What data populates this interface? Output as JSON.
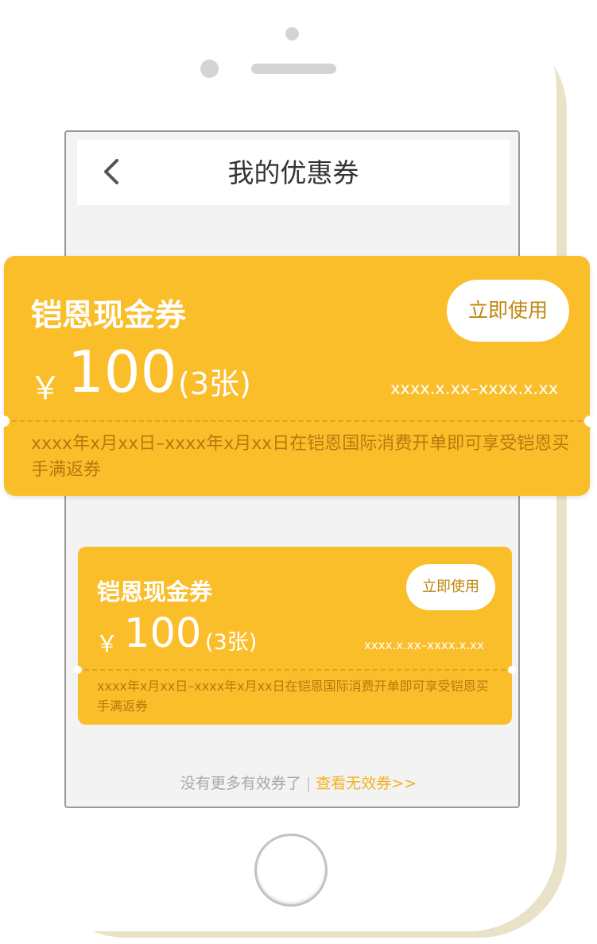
{
  "header": {
    "title": "我的优惠券"
  },
  "coupons": [
    {
      "name": "铠恩现金券",
      "action_label": "立即使用",
      "currency": "￥",
      "amount": "100",
      "count": "(3张)",
      "validity": "xxxx.x.xx–xxxx.x.xx",
      "description": "xxxx年x月xx日–xxxx年x月xx日在铠恩国际消费开单即可享受铠恩买手满返券"
    },
    {
      "name": "铠恩现金券",
      "action_label": "立即使用",
      "currency": "￥",
      "amount": "100",
      "count": "(3张)",
      "validity": "xxxx.x.xx–xxxx.x.xx",
      "description": "xxxx年x月xx日–xxxx年x月xx日在铠恩国际消费开单即可享受铠恩买手满返券"
    }
  ],
  "footer": {
    "no_more_text": "没有更多有效券了",
    "separator": "|",
    "invalid_link": "查看无效券>>"
  },
  "colors": {
    "coupon_bg": "#fbbe2b",
    "accent_text": "#f2b220",
    "phone_shadow": "#e8e2c9"
  }
}
